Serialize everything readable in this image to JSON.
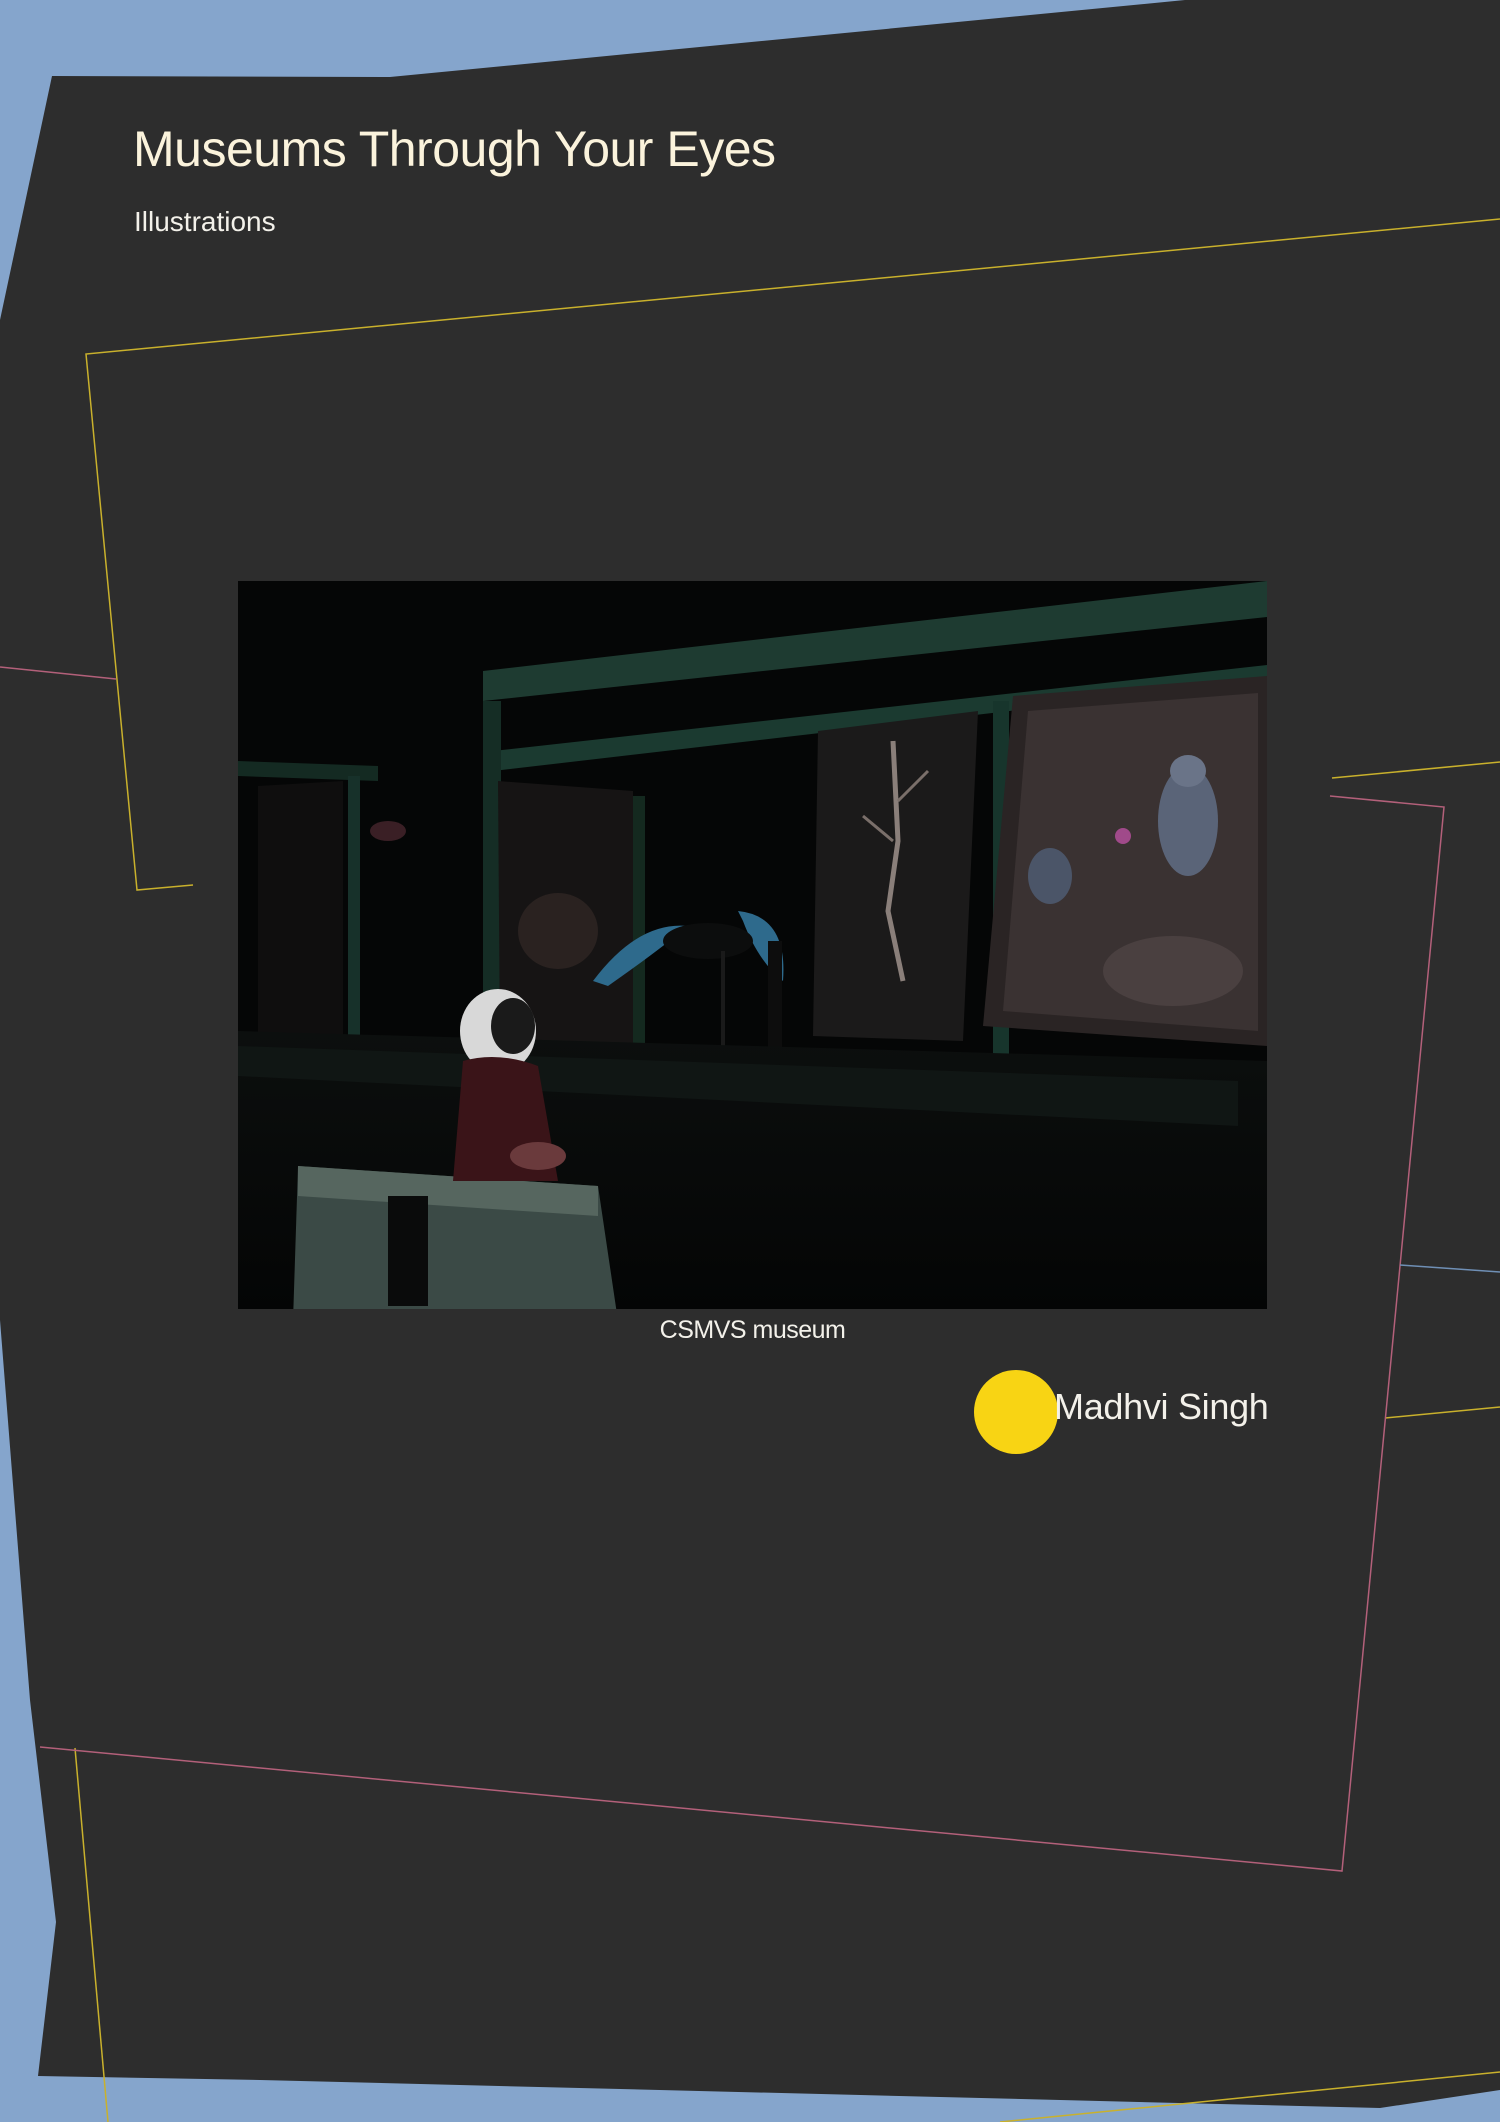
{
  "header": {
    "title": "Museums Through Your Eyes",
    "subtitle": "Illustrations"
  },
  "figure": {
    "caption": "CSMVS museum",
    "image_description_icon": "museum-gallery-illustration"
  },
  "author": {
    "name": "Madhvi Singh"
  },
  "colors": {
    "background_outer": "#85a5cc",
    "background_panel": "#2d2d2d",
    "accent_yellow": "#f8d414",
    "line_yellow": "#c9b12c",
    "line_pink": "#b3607a",
    "line_blue": "#6f8fb5",
    "title_text": "#fbf3dc",
    "body_text": "#f3f1ea"
  }
}
